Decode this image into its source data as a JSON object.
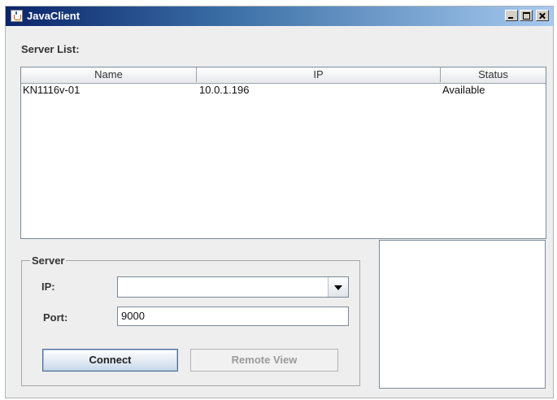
{
  "window": {
    "title": "JavaClient"
  },
  "server_list": {
    "label": "Server List:",
    "columns": [
      "Name",
      "IP",
      "Status"
    ],
    "rows": [
      {
        "name": "KN1116v-01",
        "ip": "10.0.1.196",
        "status": "Available"
      }
    ]
  },
  "server": {
    "legend": "Server",
    "ip_label": "IP:",
    "ip_value": "",
    "port_label": "Port:",
    "port_value": "9000",
    "connect_label": "Connect",
    "remote_view_label": "Remote View"
  },
  "icons": [
    "java-app-icon",
    "minimize-icon",
    "maximize-icon",
    "close-icon",
    "chevron-down-icon"
  ],
  "colors": {
    "titlebar_start": "#0a246a",
    "titlebar_end": "#a6caf0",
    "panel_bg": "#eeeeee",
    "disabled_text": "#9a9a9a"
  }
}
